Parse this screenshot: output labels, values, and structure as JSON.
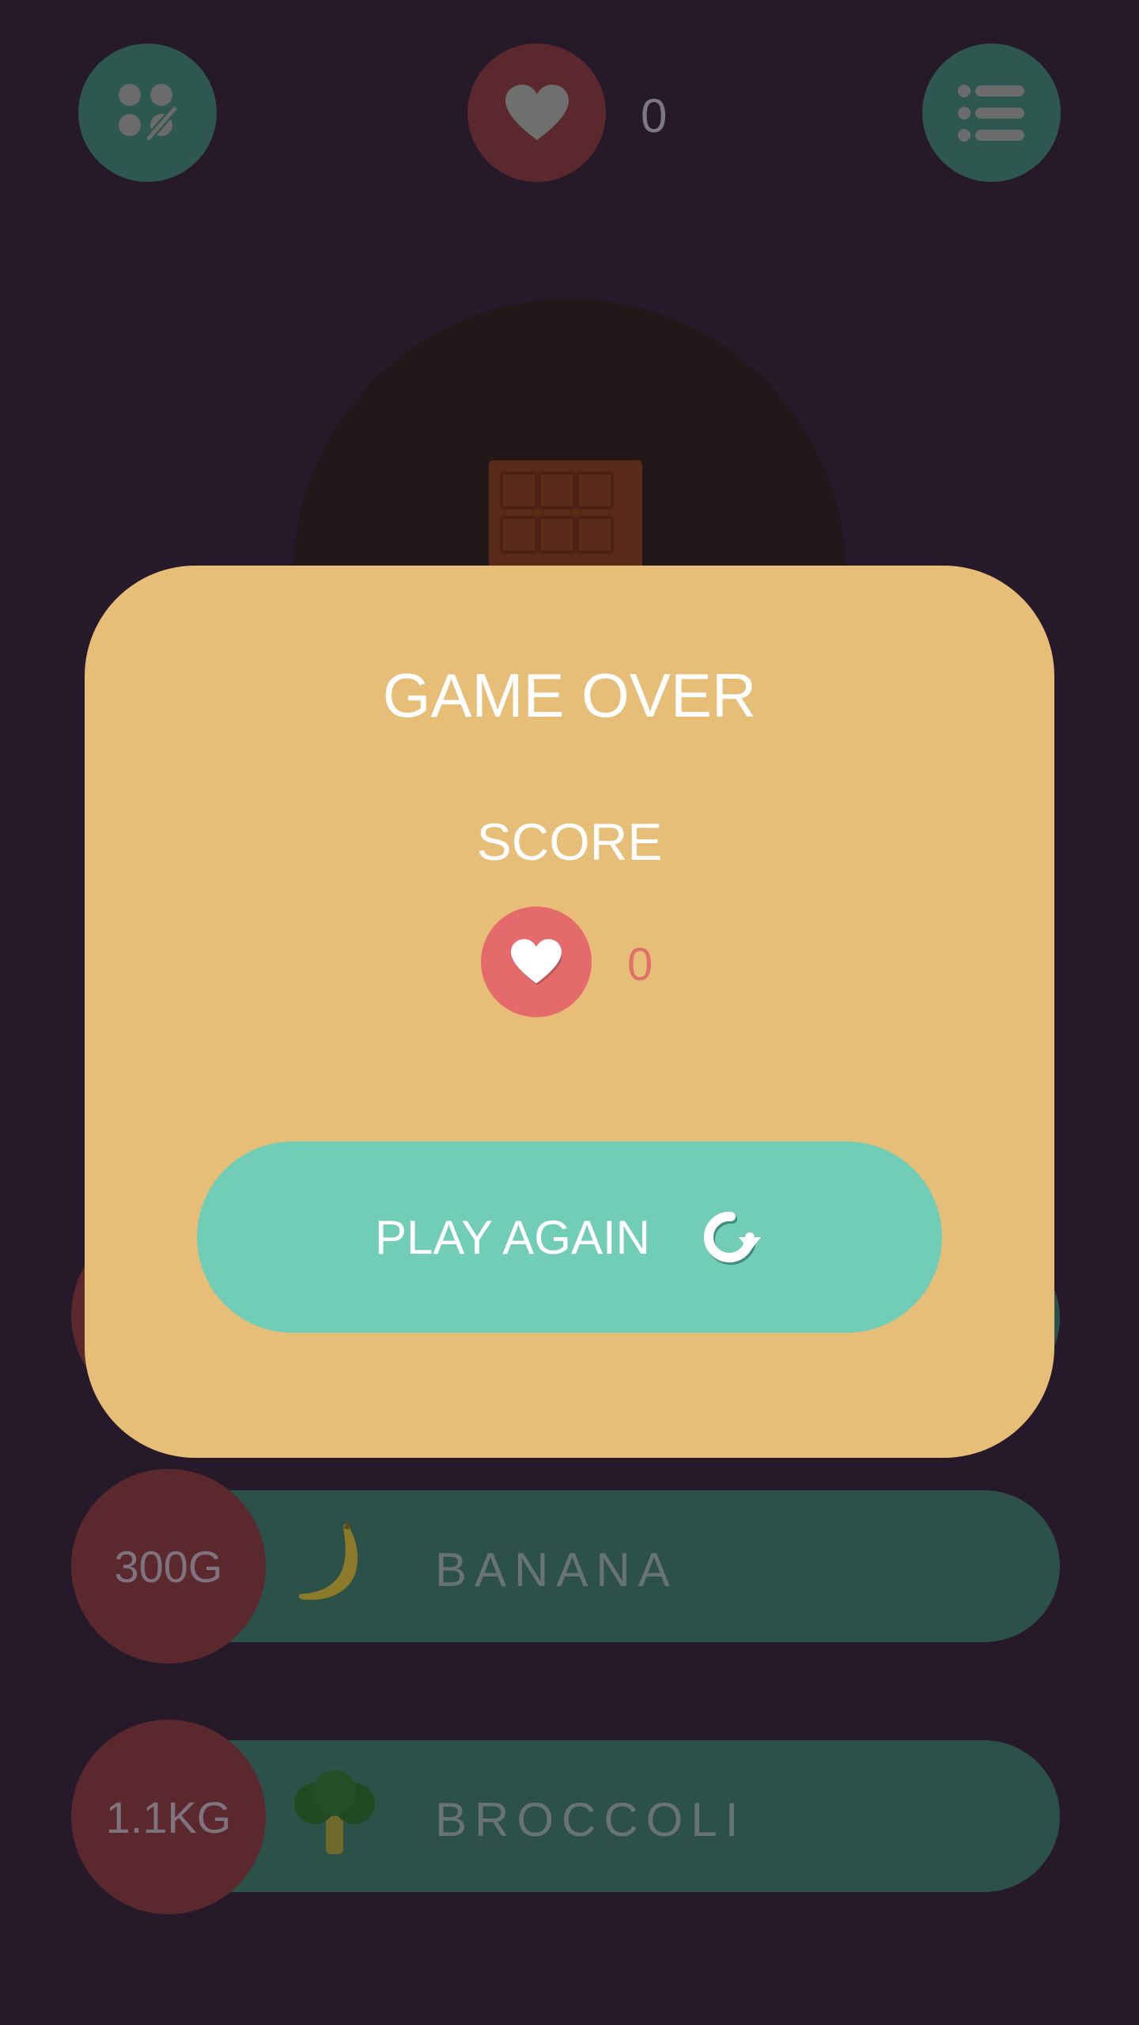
{
  "header": {
    "left_icon": "tiles-edit-icon",
    "heart_icon": "heart-icon",
    "lives_count": "0",
    "right_icon": "list-icon"
  },
  "game_area": {
    "item_icon": "chocolate-bar-icon"
  },
  "rows": [
    {
      "weight": "300G",
      "label": "BANANA",
      "icon": "banana-icon"
    },
    {
      "weight": "1.1KG",
      "label": "BROCCOLI",
      "icon": "broccoli-icon"
    }
  ],
  "modal": {
    "title": "GAME OVER",
    "score_label": "SCORE",
    "score_icon": "heart-icon",
    "score_value": "0",
    "play_again_label": "PLAY AGAIN",
    "play_again_icon": "refresh-icon"
  },
  "colors": {
    "background": "#26192a",
    "modal": "#e7be78",
    "accent_teal": "#72cdb7",
    "accent_red": "#e46a6c"
  }
}
